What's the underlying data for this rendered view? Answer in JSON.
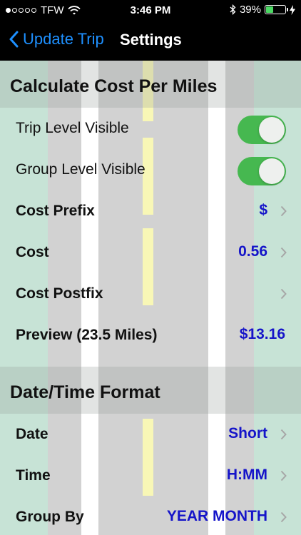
{
  "status_bar": {
    "carrier": "TFW",
    "time": "3:46 PM",
    "battery_percent": "39%",
    "battery_level": 0.39,
    "signal_dots_filled": 1,
    "signal_dots_total": 5
  },
  "navbar": {
    "back_label": "Update Trip",
    "title": "Settings"
  },
  "sections": {
    "cost": {
      "header": "Calculate Cost Per Miles",
      "trip_level_label": "Trip Level Visible",
      "trip_level_on": true,
      "group_level_label": "Group Level Visible",
      "group_level_on": true,
      "cost_prefix_label": "Cost Prefix",
      "cost_prefix_value": "$",
      "cost_label": "Cost",
      "cost_value": "0.56",
      "cost_postfix_label": "Cost Postfix",
      "cost_postfix_value": "",
      "preview_label": "Preview (23.5 Miles)",
      "preview_value": "$13.16"
    },
    "datetime": {
      "header": "Date/Time Format",
      "date_label": "Date",
      "date_value": "Short",
      "time_label": "Time",
      "time_value": "H:MM",
      "group_by_label": "Group By",
      "group_by_value": "YEAR MONTH"
    }
  },
  "colors": {
    "accent": "#1e90ff",
    "value_text": "#1514c9",
    "toggle_on": "#46b850",
    "road_green": "#c7e3d6",
    "road_grey": "#d2d2d2",
    "road_yellow": "#f8f7b6"
  },
  "icons": {
    "back": "chevron-left-icon",
    "disclosure": "chevron-right-icon",
    "wifi": "wifi-icon",
    "bluetooth": "bluetooth-icon",
    "battery": "battery-icon",
    "charging": "lightning-bolt-icon"
  }
}
